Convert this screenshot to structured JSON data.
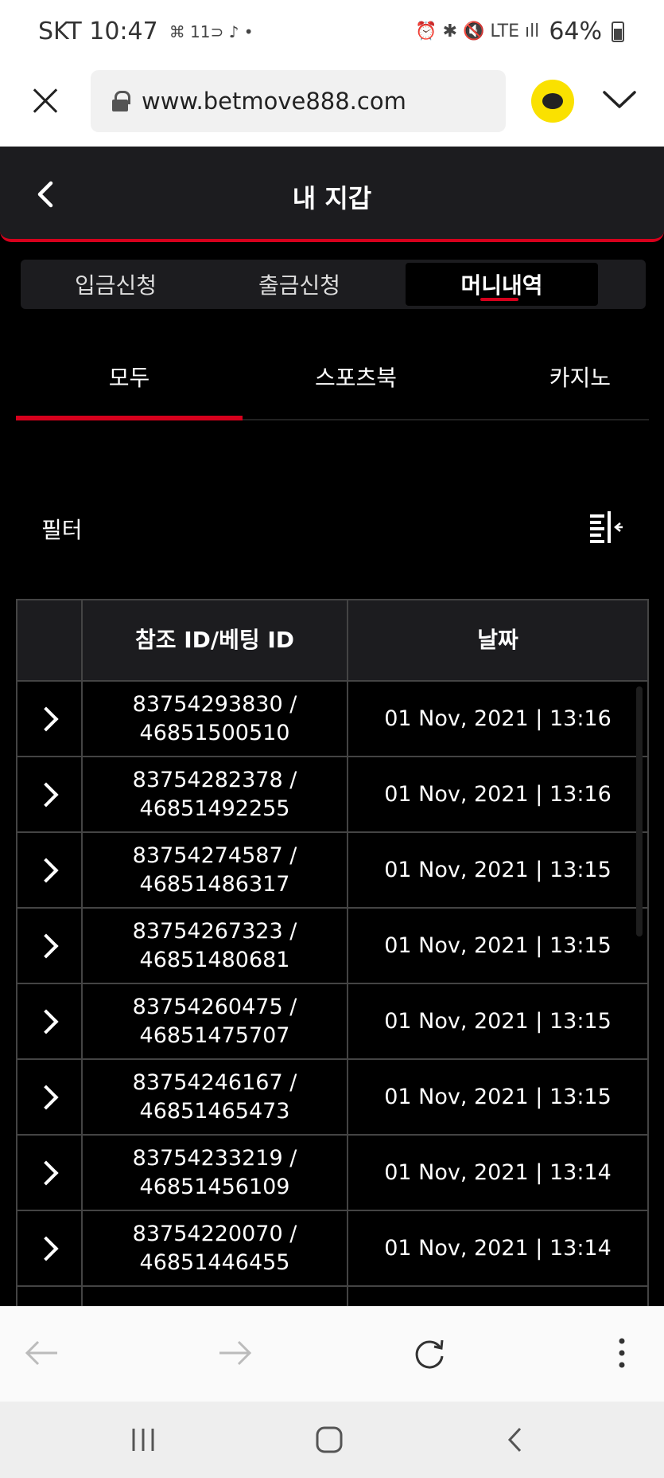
{
  "status_bar": {
    "carrier_time": "SKT 10:47",
    "left_icons": "⌘ 11⊃ ♪ •",
    "right_icons": "⏰ ✱ 🔇 LTE ıll",
    "battery": "64%"
  },
  "browser": {
    "url": "www.betmove888.com"
  },
  "header": {
    "title": "내 지갑"
  },
  "main_tabs": [
    {
      "label": "입금신청"
    },
    {
      "label": "출금신청"
    },
    {
      "label": "머니내역"
    }
  ],
  "sub_tabs": [
    {
      "label": "모두"
    },
    {
      "label": "스포츠북"
    },
    {
      "label": "카지노"
    }
  ],
  "filter": {
    "label": "필터"
  },
  "table": {
    "columns": [
      "",
      "참조 ID/베팅 ID",
      "날짜"
    ],
    "rows": [
      {
        "ref_id": "83754293830 /",
        "bet_id": "46851500510",
        "date": "01 Nov, 2021 | 13:16"
      },
      {
        "ref_id": "83754282378 /",
        "bet_id": "46851492255",
        "date": "01 Nov, 2021 | 13:16"
      },
      {
        "ref_id": "83754274587 /",
        "bet_id": "46851486317",
        "date": "01 Nov, 2021 | 13:15"
      },
      {
        "ref_id": "83754267323 /",
        "bet_id": "46851480681",
        "date": "01 Nov, 2021 | 13:15"
      },
      {
        "ref_id": "83754260475 /",
        "bet_id": "46851475707",
        "date": "01 Nov, 2021 | 13:15"
      },
      {
        "ref_id": "83754246167 /",
        "bet_id": "46851465473",
        "date": "01 Nov, 2021 | 13:15"
      },
      {
        "ref_id": "83754233219 /",
        "bet_id": "46851456109",
        "date": "01 Nov, 2021 | 13:14"
      },
      {
        "ref_id": "83754220070 /",
        "bet_id": "46851446455",
        "date": "01 Nov, 2021 | 13:14"
      }
    ]
  },
  "colors": {
    "accent": "#d6001c",
    "background": "#000000",
    "panel": "#1c1c1f",
    "kakao": "#fae100"
  }
}
